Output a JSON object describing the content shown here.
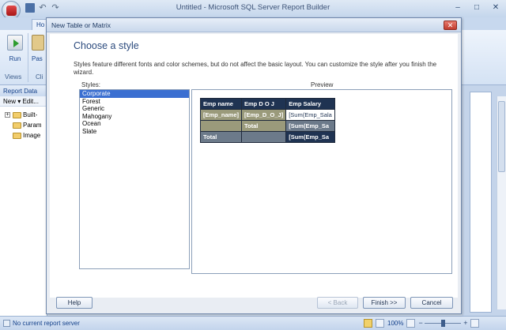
{
  "app": {
    "title": "Untitled - Microsoft SQL Server Report Builder",
    "ribbon": {
      "home_tab": "Ho",
      "run_label": "Run",
      "paste_label": "Pas",
      "views_group": "Views",
      "clipboard_group": "Cli"
    },
    "report_data": {
      "header": "Report Data",
      "toolbar": "New ▾  Edit...",
      "items": [
        {
          "label": "Built-"
        },
        {
          "label": "Param"
        },
        {
          "label": "Image"
        }
      ]
    },
    "status": {
      "server": "No current report server",
      "zoom": "100%",
      "zoom_percent": 50
    },
    "window_controls": {
      "minimize": "–",
      "maximize": "□",
      "close": "✕"
    }
  },
  "dialog": {
    "title": "New Table or Matrix",
    "close": "✕",
    "heading": "Choose a style",
    "description": "Styles feature different fonts and color schemes, but do not affect the basic layout. You can customize the style after you finish the wizard.",
    "styles_label": "Styles:",
    "preview_label": "Preview",
    "styles": [
      "Corporate",
      "Forest",
      "Generic",
      "Mahogany",
      "Ocean",
      "Slate"
    ],
    "selected_style": "Corporate",
    "preview": {
      "headers": [
        "Emp name",
        "Emp D O J",
        "Emp Salary"
      ],
      "group_row": [
        "[Emp_name]",
        "[Emp_D_O_J]",
        "[Sum(Emp_Sala"
      ],
      "subtotal_row": [
        "",
        "Total",
        "[Sum(Emp_Sa"
      ],
      "grand_total_row": [
        "Total",
        "",
        "[Sum(Emp_Sa"
      ]
    },
    "buttons": {
      "help": "Help",
      "back": "< Back",
      "finish": "Finish >>",
      "cancel": "Cancel"
    }
  }
}
